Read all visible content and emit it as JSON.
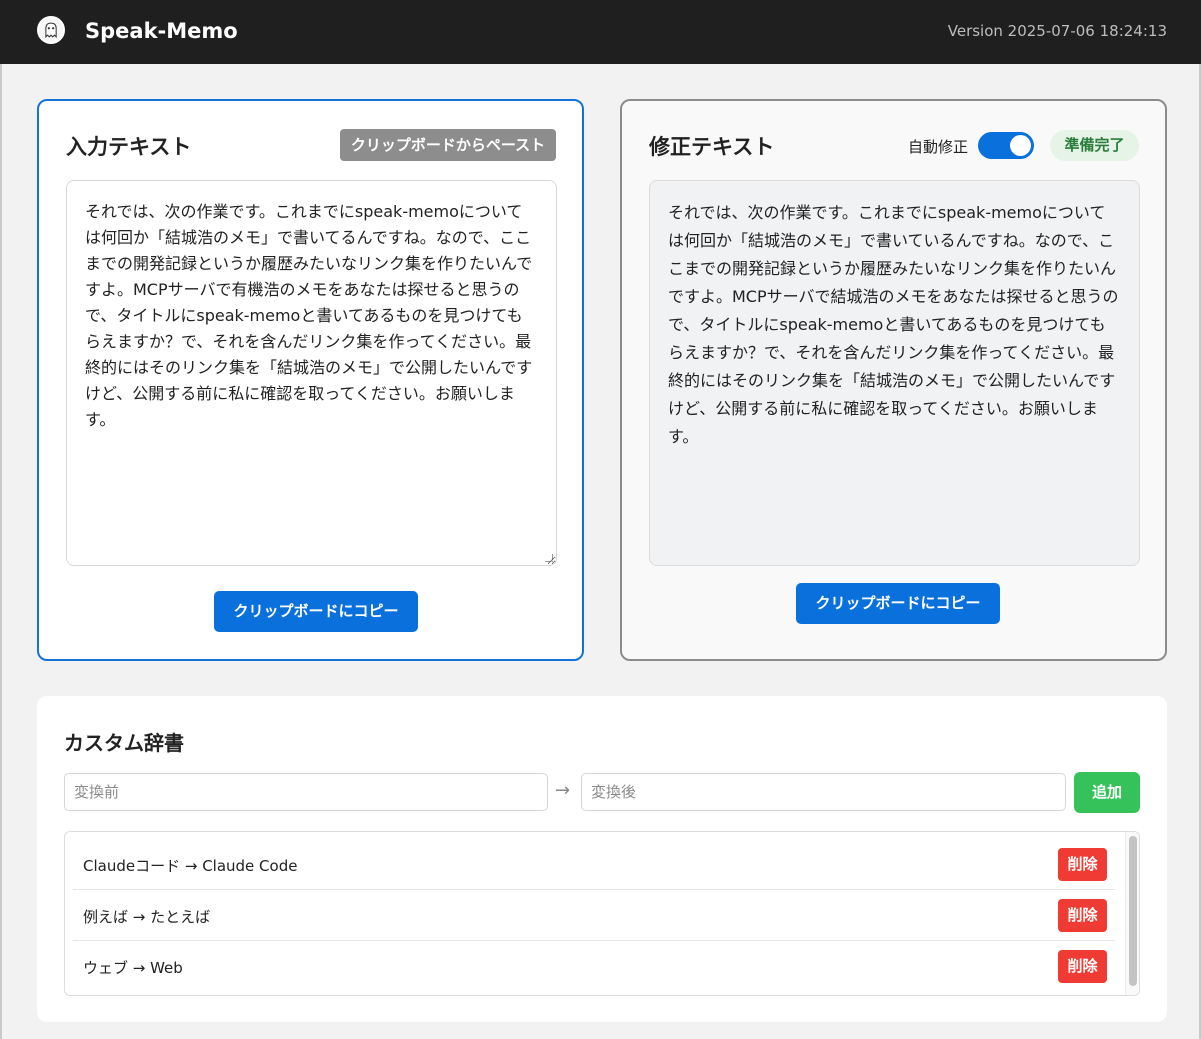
{
  "header": {
    "title": "Speak-Memo",
    "version": "Version 2025-07-06 18:24:13",
    "logo_icon": "ghost-icon"
  },
  "input_panel": {
    "title": "入力テキスト",
    "paste_label": "クリップボードからペースト",
    "text": "それでは、次の作業です。これまでにspeak-memoについては何回か「結城浩のメモ」で書いてるんですね。なので、ここまでの開発記録というか履歴みたいなリンク集を作りたいんですよ。MCPサーバで有機浩のメモをあなたは探せると思うので、タイトルにspeak-memoと書いてあるものを見つけてもらえますか？で、それを含んだリンク集を作ってください。最終的にはそのリンク集を「結城浩のメモ」で公開したいんですけど、公開する前に私に確認を取ってください。お願いします。",
    "copy_label": "クリップボードにコピー"
  },
  "output_panel": {
    "title": "修正テキスト",
    "auto_fix_label": "自動修正",
    "auto_fix_on": true,
    "status": "準備完了",
    "text": "それでは、次の作業です。これまでにspeak-memoについては何回か「結城浩のメモ」で書いているんですね。なので、ここまでの開発記録というか履歴みたいなリンク集を作りたいんですよ。MCPサーバで結城浩のメモをあなたは探せると思うので、タイトルにspeak-memoと書いてあるものを見つけてもらえますか？で、それを含んだリンク集を作ってください。最終的にはそのリンク集を「結城浩のメモ」で公開したいんですけど、公開する前に私に確認を取ってください。お願いします。",
    "copy_label": "クリップボードにコピー"
  },
  "dictionary": {
    "title": "カスタム辞書",
    "from_placeholder": "変換前",
    "to_placeholder": "変換後",
    "arrow": "→",
    "add_label": "追加",
    "entries": [
      {
        "text": "Claudeコード → Claude Code",
        "delete_label": "削除"
      },
      {
        "text": "例えば → たとえば",
        "delete_label": "削除"
      },
      {
        "text": "ウェブ → Web",
        "delete_label": "削除"
      }
    ]
  },
  "colors": {
    "accent": "#0a70dc",
    "add": "#35c25a",
    "delete": "#ef3b33",
    "header_bg": "#1f1f1f"
  }
}
